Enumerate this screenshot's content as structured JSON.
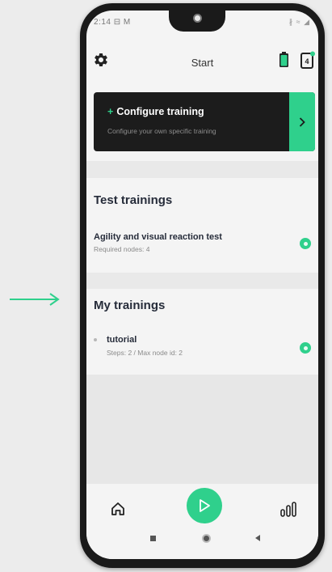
{
  "status_bar": {
    "time": "2:14 ⊟ M",
    "right_icons": "∦ ≈ ◢"
  },
  "app_bar": {
    "title": "Start",
    "settings_icon": "gear-icon",
    "battery_icon": "battery-icon",
    "device_icon": "device-icon"
  },
  "config_card": {
    "title": "Configure training",
    "subtitle": "Configure your own specific training",
    "plus": "+"
  },
  "test_trainings": {
    "heading": "Test trainings",
    "items": [
      {
        "title": "Agility and visual reaction test",
        "subtitle": "Required nodes: 4"
      }
    ]
  },
  "my_trainings": {
    "heading": "My trainings",
    "items": [
      {
        "title": "tutorial",
        "subtitle": "Steps: 2 / Max node id: 2"
      }
    ]
  },
  "bottom_nav": {
    "home_icon": "home-icon",
    "play_icon": "play-icon",
    "stats_icon": "bar-chart-icon"
  },
  "colors": {
    "accent": "#2fd08c",
    "dark_card": "#1c1c1c",
    "heading": "#262c3a",
    "background": "#ececec"
  }
}
